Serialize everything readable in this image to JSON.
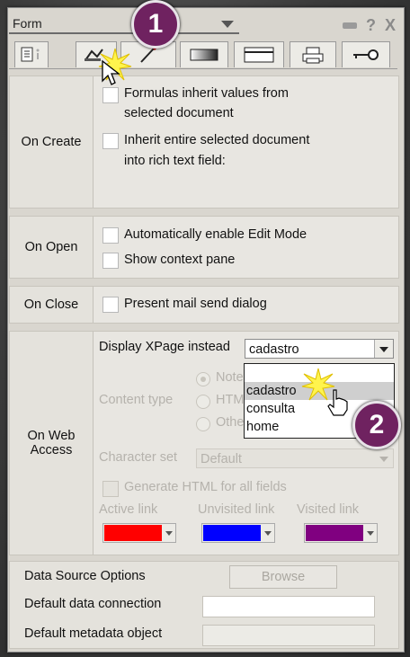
{
  "header": {
    "title": "Form",
    "help_label": "?",
    "close_label": "X"
  },
  "tabs": [
    {
      "name": "info-tab",
      "icon": "info-icon"
    },
    {
      "name": "launch-tab",
      "icon": "launch-icon"
    },
    {
      "name": "wand-tab",
      "icon": "wand-icon"
    },
    {
      "name": "background-tab",
      "icon": "background-icon"
    },
    {
      "name": "header-tab",
      "icon": "header-icon"
    },
    {
      "name": "print-tab",
      "icon": "printer-icon"
    },
    {
      "name": "security-tab",
      "icon": "key-icon"
    }
  ],
  "on_create": {
    "label": "On Create",
    "option1_line1": "Formulas inherit values from",
    "option1_line2": "selected document",
    "option2_line1": "Inherit entire selected document",
    "option2_line2": "into rich text field:"
  },
  "on_open": {
    "label": "On Open",
    "option1": "Automatically enable Edit Mode",
    "option2": "Show context pane"
  },
  "on_close": {
    "label": "On Close",
    "option1": "Present mail send dialog"
  },
  "on_web": {
    "label_line1": "On Web",
    "label_line2": "Access",
    "display_xpage_label": "Display XPage instead",
    "display_xpage_value": "cadastro",
    "xpage_options": [
      "",
      "cadastro",
      "consulta",
      "home"
    ],
    "highlighted_option": "cadastro",
    "content_type_label": "Content type",
    "content_type_options": [
      "Notes",
      "HTML",
      "Other"
    ],
    "character_set_label": "Character set",
    "character_set_value": "Default",
    "generate_html_label": "Generate HTML for all fields",
    "active_link_label": "Active link",
    "unvisited_link_label": "Unvisited link",
    "visited_link_label": "Visited link",
    "active_link_color": "#ff0000",
    "unvisited_link_color": "#0000ff",
    "visited_link_color": "#800080"
  },
  "data_source": {
    "options_label": "Data Source Options",
    "browse_label": "Browse",
    "default_connection_label": "Default data connection",
    "default_metadata_label": "Default metadata object"
  },
  "callouts": {
    "step1": "1",
    "step2": "2"
  }
}
